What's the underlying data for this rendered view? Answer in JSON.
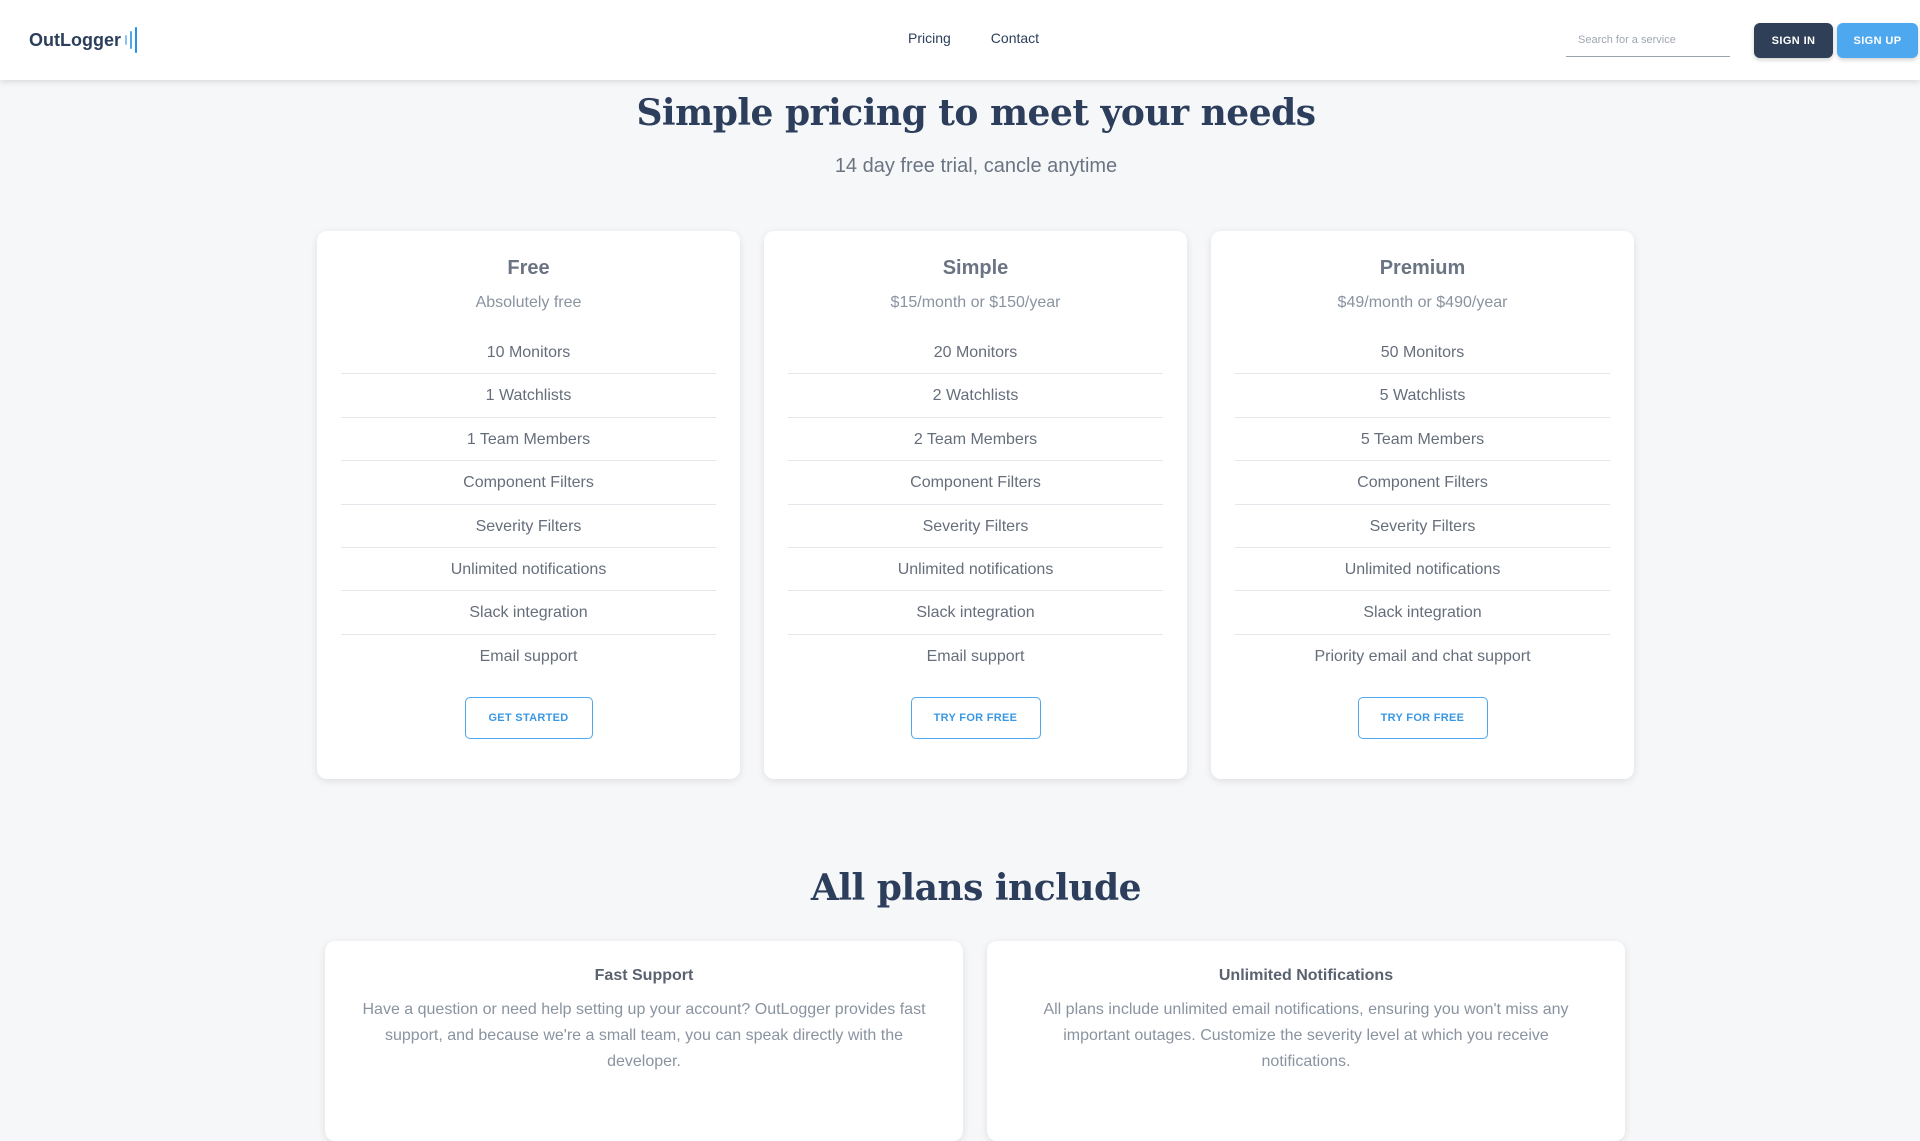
{
  "header": {
    "logo_text": "OutLogger",
    "nav": [
      "Pricing",
      "Contact"
    ],
    "search_placeholder": "Search for a service",
    "signin_label": "SIGN IN",
    "signup_label": "SIGN UP",
    "accent": "#4ea8ef"
  },
  "hero": {
    "title": "Simple pricing to meet your needs",
    "subtitle": "14 day free trial, cancle anytime"
  },
  "plans": [
    {
      "name": "Free",
      "price": "Absolutely free",
      "features": [
        "10 Monitors",
        "1 Watchlists",
        "1 Team Members",
        "Component Filters",
        "Severity Filters",
        "Unlimited notifications",
        "Slack integration",
        "Email support"
      ],
      "cta": "GET STARTED"
    },
    {
      "name": "Simple",
      "price": "$15/month or $150/year",
      "features": [
        "20 Monitors",
        "2 Watchlists",
        "2 Team Members",
        "Component Filters",
        "Severity Filters",
        "Unlimited notifications",
        "Slack integration",
        "Email support"
      ],
      "cta": "TRY FOR FREE"
    },
    {
      "name": "Premium",
      "price": "$49/month or $490/year",
      "features": [
        "50 Monitors",
        "5 Watchlists",
        "5 Team Members",
        "Component Filters",
        "Severity Filters",
        "Unlimited notifications",
        "Slack integration",
        "Priority email and chat support"
      ],
      "cta": "TRY FOR FREE"
    }
  ],
  "includes": {
    "title": "All plans include",
    "items": [
      {
        "title": "Fast Support",
        "text": "Have a question or need help setting up your account? OutLogger provides fast support, and because we're a small team, you can speak directly with the developer."
      },
      {
        "title": "Unlimited Notifications",
        "text": "All plans include unlimited email notifications, ensuring you won't miss any important outages. Customize the severity level at which you receive notifications."
      }
    ]
  }
}
